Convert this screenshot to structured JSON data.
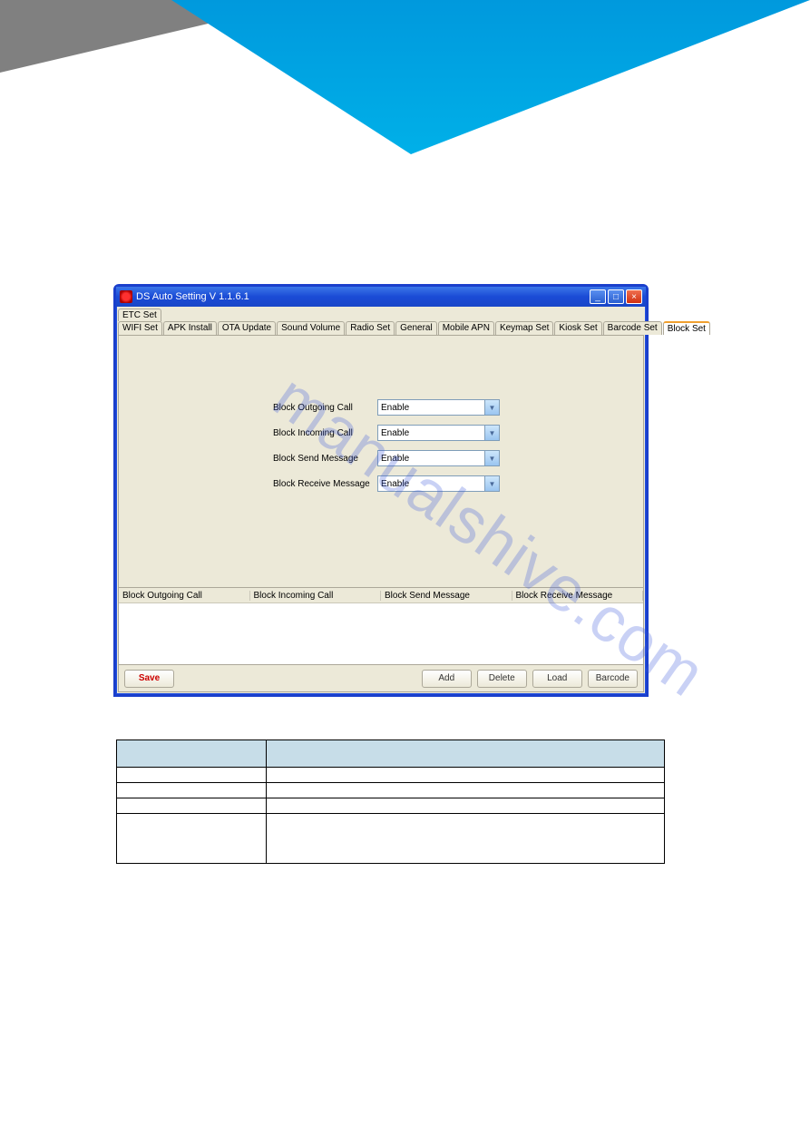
{
  "header": {},
  "watermark": "manualshive.com",
  "window": {
    "title": "DS Auto Setting    V 1.1.6.1",
    "controls": {
      "min": "_",
      "max": "□",
      "close": "×"
    },
    "tabrow1": [
      {
        "label": "ETC Set",
        "active": false
      }
    ],
    "tabrow2": [
      {
        "label": "WIFI Set"
      },
      {
        "label": "APK Install"
      },
      {
        "label": "OTA Update"
      },
      {
        "label": "Sound Volume"
      },
      {
        "label": "Radio Set"
      },
      {
        "label": "General"
      },
      {
        "label": "Mobile APN"
      },
      {
        "label": "Keymap Set"
      },
      {
        "label": "Kiosk Set"
      },
      {
        "label": "Barcode Set"
      },
      {
        "label": "Block Set",
        "active": true
      }
    ],
    "fields": [
      {
        "label": "Block Outgoing Call",
        "value": "Enable"
      },
      {
        "label": "Block Incoming Call",
        "value": "Enable"
      },
      {
        "label": "Block Send Message",
        "value": "Enable"
      },
      {
        "label": "Block Receive Message",
        "value": "Enable"
      }
    ],
    "grid_headers": [
      "Block Outgoing Call",
      "Block Incoming Call",
      "Block Send Message",
      "Block Receive Message"
    ],
    "buttons": {
      "save": "Save",
      "add": "Add",
      "delete": "Delete",
      "load": "Load",
      "barcode": "Barcode"
    }
  },
  "desc": {
    "headers": [
      "",
      ""
    ],
    "rows": [
      {
        "c1": "",
        "c2": ""
      },
      {
        "c1": "",
        "c2": ""
      },
      {
        "c1": "",
        "c2": ""
      },
      {
        "c1": "",
        "c2": "",
        "tall": true
      }
    ]
  }
}
